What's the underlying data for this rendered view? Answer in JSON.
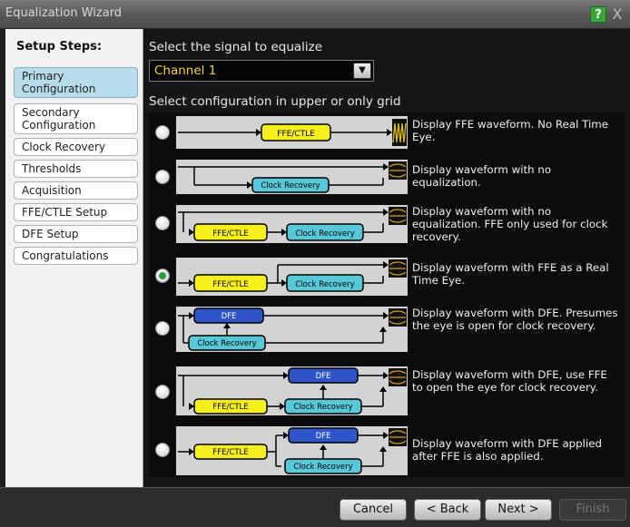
{
  "window": {
    "title": "Equalization Wizard",
    "help_label": "?",
    "close_label": "X"
  },
  "sidebar": {
    "heading": "Setup Steps:",
    "items": [
      {
        "label": "Primary Configuration",
        "active": true
      },
      {
        "label": "Secondary Configuration",
        "active": false
      },
      {
        "label": "Clock Recovery",
        "active": false
      },
      {
        "label": "Thresholds",
        "active": false
      },
      {
        "label": "Acquisition",
        "active": false
      },
      {
        "label": "FFE/CTLE Setup",
        "active": false
      },
      {
        "label": "DFE Setup",
        "active": false
      },
      {
        "label": "Congratulations",
        "active": false
      }
    ]
  },
  "main": {
    "signal_label": "Select the signal to equalize",
    "signal_value": "Channel 1",
    "config_label": "Select configuration in upper or only grid",
    "options": [
      {
        "description": "Display FFE waveform. No Real Time Eye.",
        "selected": false,
        "blocks": {
          "ffe": "FFE/CTLE"
        }
      },
      {
        "description": "Display waveform with no equalization.",
        "selected": false,
        "blocks": {
          "cr": "Clock Recovery"
        }
      },
      {
        "description": "Display waveform with no equalization. FFE only used for clock recovery.",
        "selected": false,
        "blocks": {
          "ffe": "FFE/CTLE",
          "cr": "Clock Recovery"
        }
      },
      {
        "description": "Display waveform with FFE as a Real Time Eye.",
        "selected": true,
        "blocks": {
          "ffe": "FFE/CTLE",
          "cr": "Clock Recovery"
        }
      },
      {
        "description": "Display waveform with DFE. Presumes the eye is open for clock recovery.",
        "selected": false,
        "blocks": {
          "dfe": "DFE",
          "cr": "Clock Recovery"
        }
      },
      {
        "description": "Display waveform with DFE, use FFE to open the eye for clock recovery.",
        "selected": false,
        "blocks": {
          "dfe": "DFE",
          "ffe": "FFE/CTLE",
          "cr": "Clock Recovery"
        }
      },
      {
        "description": "Display waveform with DFE applied after FFE is also applied.",
        "selected": false,
        "blocks": {
          "dfe": "DFE",
          "ffe": "FFE/CTLE",
          "cr": "Clock Recovery"
        }
      }
    ]
  },
  "buttons": {
    "cancel": "Cancel",
    "back": "< Back",
    "next": "Next >",
    "finish": "Finish"
  },
  "colors": {
    "ffe_block": "#f7ef1c",
    "clock_recovery_block": "#57c8d8",
    "dfe_block": "#2d54c8",
    "selected_step": "#b9dcea",
    "radio_selected": "#22a33a",
    "signal_text": "#f5d42a"
  }
}
